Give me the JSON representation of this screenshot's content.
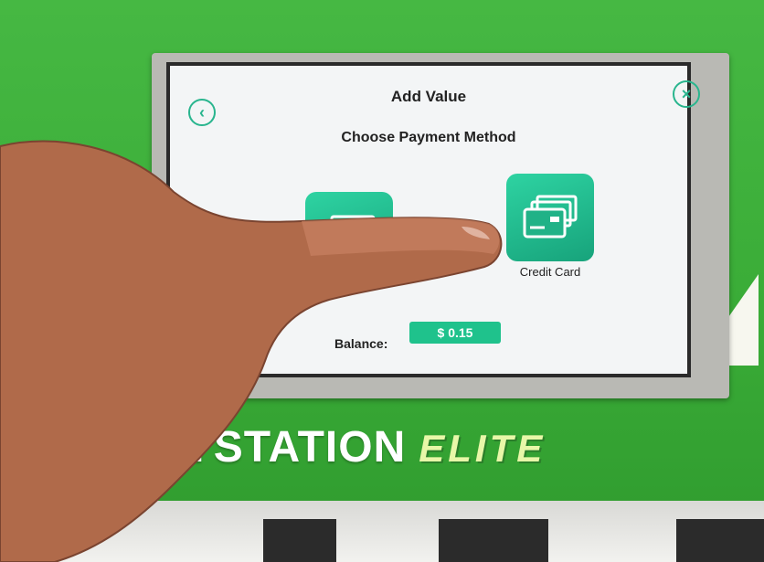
{
  "screen": {
    "title": "Add Value",
    "subtitle": "Choose Payment Method",
    "back_icon": "chevron-left-icon",
    "close_icon": "close-icon",
    "payment_methods": [
      {
        "label": "",
        "icon": "cash-icon"
      },
      {
        "label": "Credit Card",
        "icon": "credit-card-icon"
      }
    ],
    "balance_label": "Balance:",
    "balance_value": "$ 0.15"
  },
  "brand": {
    "name": "PAYSTATION",
    "tier": "ELITE"
  },
  "colors": {
    "kiosk_green": "#3cae3a",
    "accent_teal": "#1fc28c",
    "screen_bg": "#f3f5f6"
  }
}
